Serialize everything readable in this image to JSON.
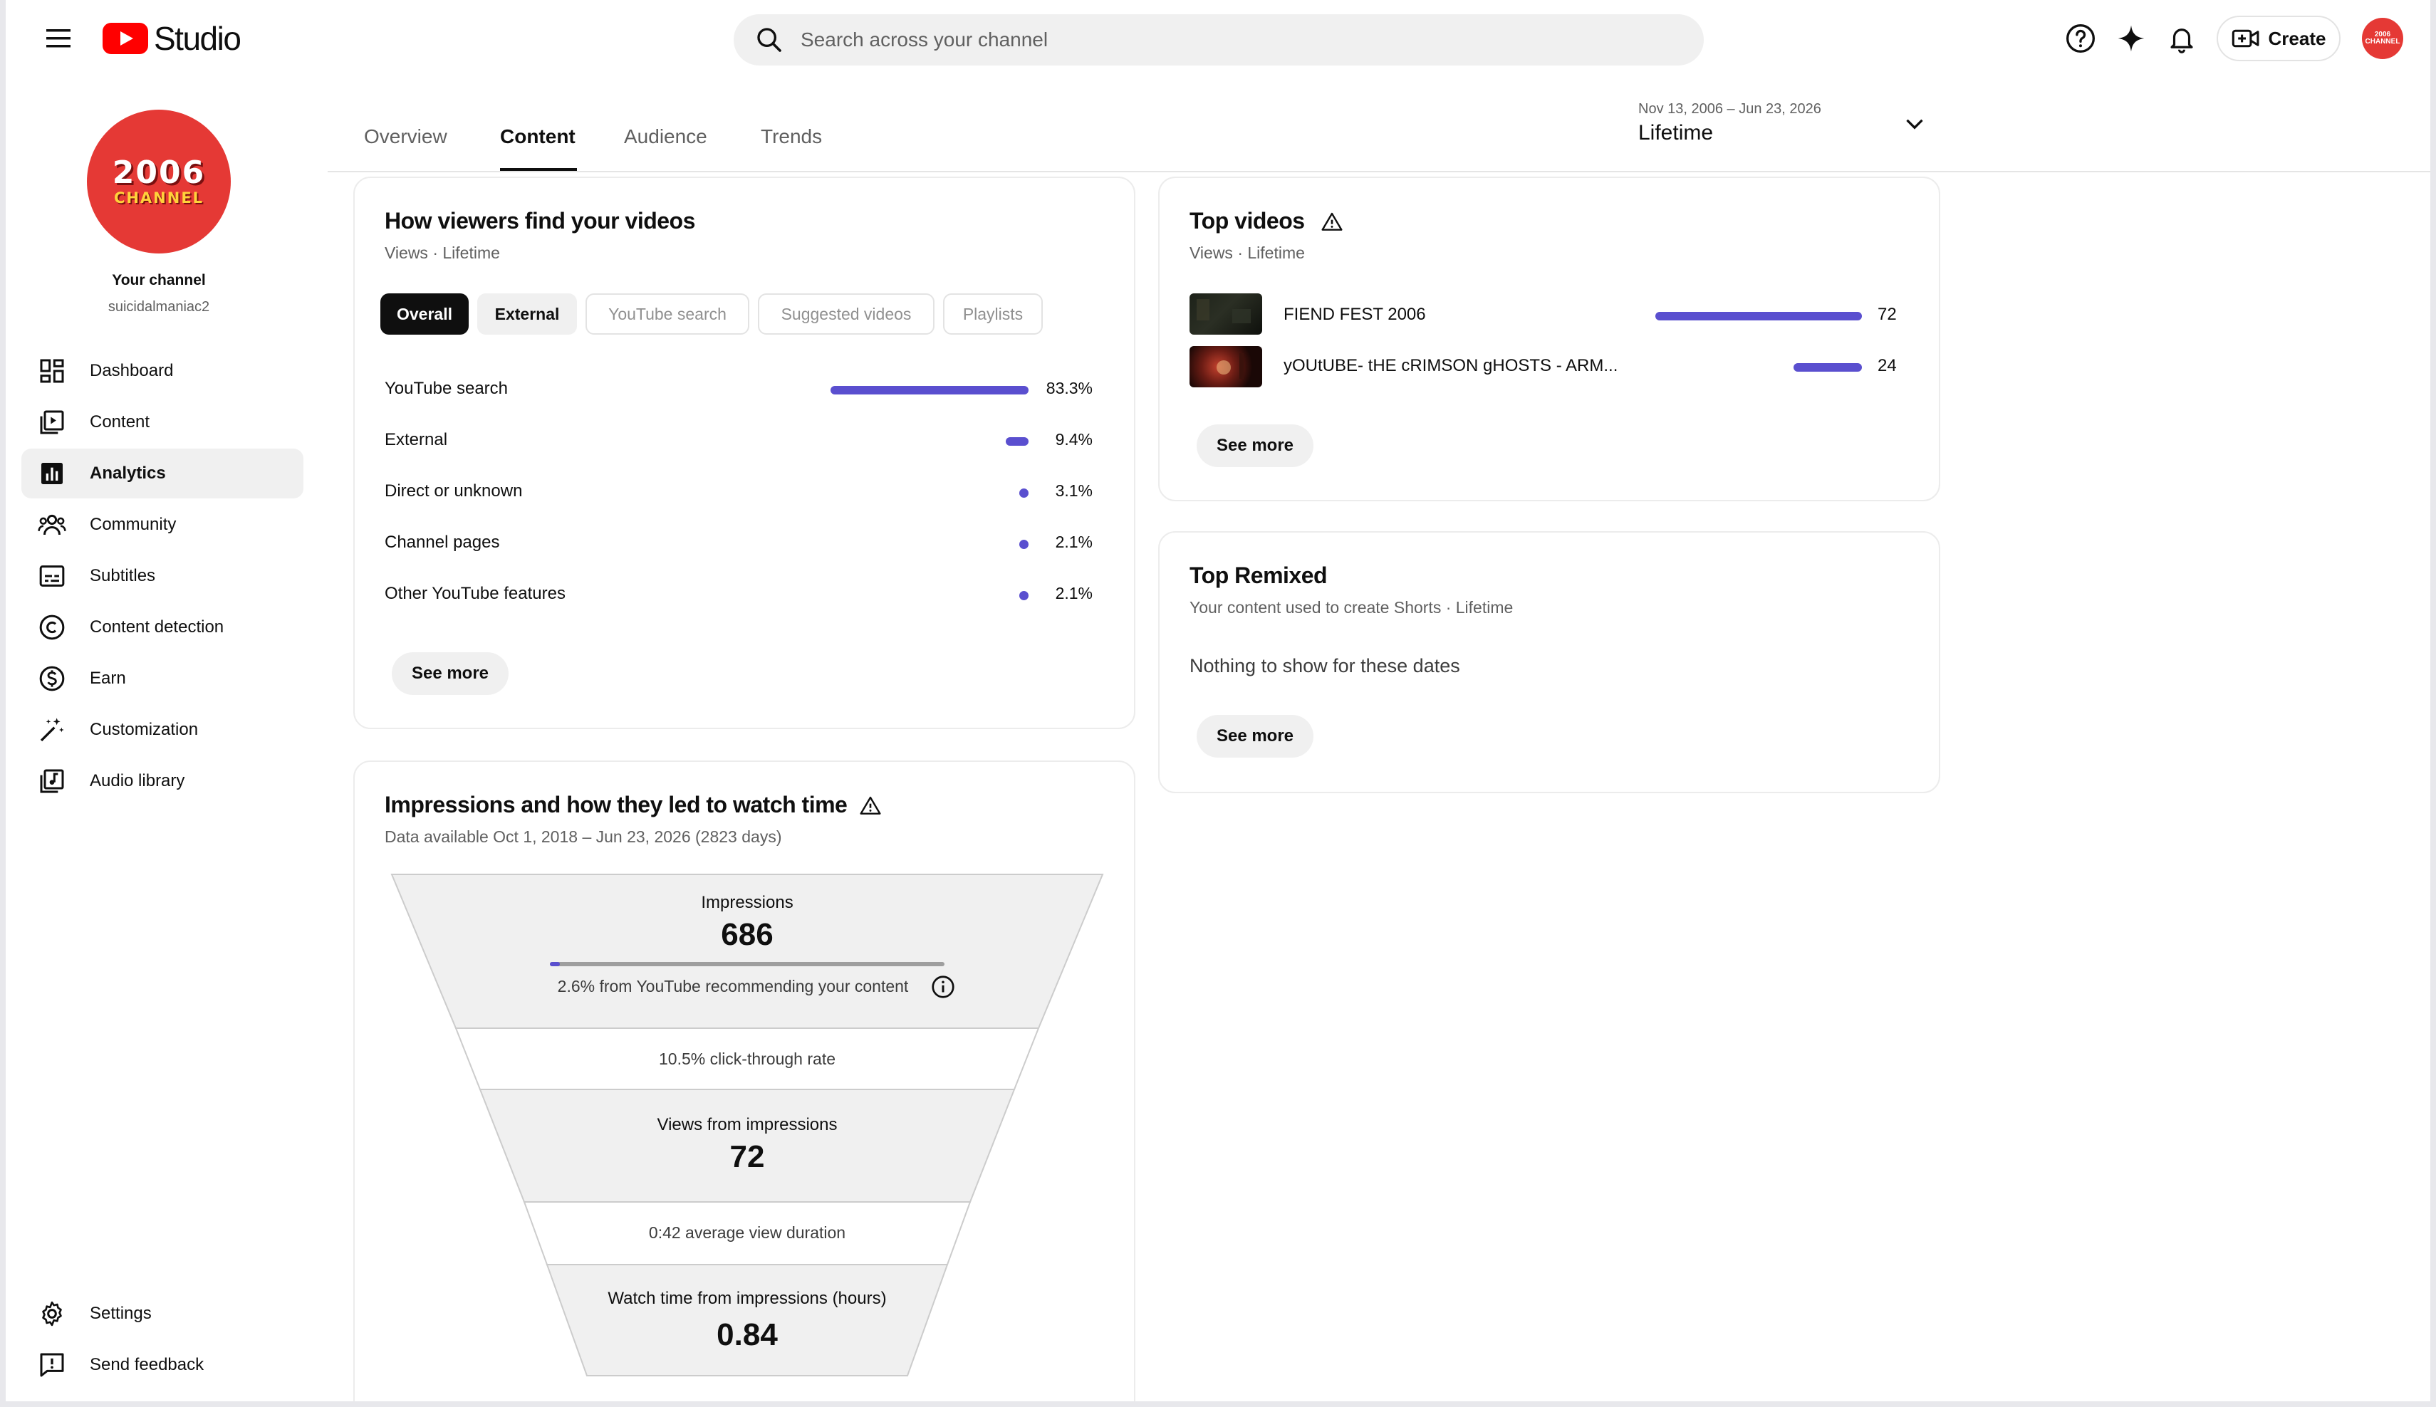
{
  "header": {
    "logo_text": "Studio",
    "search_placeholder": "Search across your channel",
    "create_label": "Create",
    "avatar_text": "2006 CHANNEL"
  },
  "channel": {
    "avatar_year": "2006",
    "avatar_word": "CHANNEL",
    "label": "Your channel",
    "handle": "suicidalmaniac2"
  },
  "sidebar": {
    "items": [
      {
        "label": "Dashboard",
        "icon": "dashboard-icon"
      },
      {
        "label": "Content",
        "icon": "content-icon"
      },
      {
        "label": "Analytics",
        "icon": "analytics-icon",
        "active": true
      },
      {
        "label": "Community",
        "icon": "community-icon"
      },
      {
        "label": "Subtitles",
        "icon": "subtitles-icon"
      },
      {
        "label": "Content detection",
        "icon": "copyright-icon"
      },
      {
        "label": "Earn",
        "icon": "dollar-icon"
      },
      {
        "label": "Customization",
        "icon": "magic-wand-icon"
      },
      {
        "label": "Audio library",
        "icon": "audio-library-icon"
      }
    ],
    "footer": [
      {
        "label": "Settings",
        "icon": "gear-icon"
      },
      {
        "label": "Send feedback",
        "icon": "feedback-icon"
      }
    ]
  },
  "tabs": {
    "items": [
      "Overview",
      "Content",
      "Audience",
      "Trends"
    ],
    "active": "Content"
  },
  "date_filter": {
    "range": "Nov 13, 2006 – Jun 23, 2026",
    "period": "Lifetime"
  },
  "traffic_sources": {
    "title": "How viewers find your videos",
    "subtitle": "Views · Lifetime",
    "chips": [
      "Overall",
      "External",
      "YouTube search",
      "Suggested videos",
      "Playlists"
    ],
    "rows": [
      {
        "label": "YouTube search",
        "value": "83.3%",
        "share": 0.833
      },
      {
        "label": "External",
        "value": "9.4%",
        "share": 0.094
      },
      {
        "label": "Direct or unknown",
        "value": "3.1%",
        "share": 0.031
      },
      {
        "label": "Channel pages",
        "value": "2.1%",
        "share": 0.021
      },
      {
        "label": "Other YouTube features",
        "value": "2.1%",
        "share": 0.021
      }
    ],
    "see_more": "See more"
  },
  "top_videos": {
    "title": "Top videos",
    "subtitle": "Views · Lifetime",
    "rows": [
      {
        "title": "FIEND FEST 2006",
        "views": "72",
        "share": 1.0
      },
      {
        "title": "yOUtUBE- tHE cRIMSON gHOSTS - ARM...",
        "views": "24",
        "share": 0.333
      }
    ],
    "see_more": "See more"
  },
  "top_remixed": {
    "title": "Top Remixed",
    "subtitle": "Your content used to create Shorts · Lifetime",
    "empty": "Nothing to show for these dates",
    "see_more": "See more"
  },
  "funnel": {
    "title": "Impressions and how they led to watch time",
    "subtitle": "Data available Oct 1, 2018 – Jun 23, 2026 (2823 days)",
    "impressions_label": "Impressions",
    "impressions_value": "686",
    "recommend_share": 0.026,
    "recommend_text": "2.6% from YouTube recommending your content",
    "ctr_text": "10.5% click-through rate",
    "views_label": "Views from impressions",
    "views_value": "72",
    "avd_text": "0:42 average view duration",
    "watch_label": "Watch time from impressions (hours)",
    "watch_value": "0.84"
  }
}
